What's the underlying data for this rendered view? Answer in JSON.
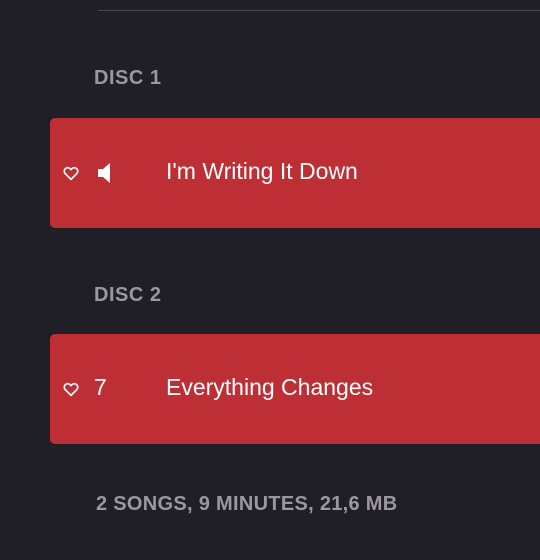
{
  "colors": {
    "background": "#211f26",
    "accent": "#be2e35",
    "muted_text": "#9a989e",
    "primary_text": "#ffffff"
  },
  "discs": [
    {
      "label": "DISC 1",
      "tracks": [
        {
          "title": "I'm Writing It Down",
          "number": "",
          "now_playing": true,
          "status_icon": "speaker-icon",
          "love_icon": "heart-icon"
        }
      ]
    },
    {
      "label": "DISC 2",
      "tracks": [
        {
          "title": "Everything Changes",
          "number": "7",
          "now_playing": false,
          "love_icon": "heart-icon"
        }
      ]
    }
  ],
  "summary": "2 SONGS, 9 MINUTES, 21,6 MB"
}
